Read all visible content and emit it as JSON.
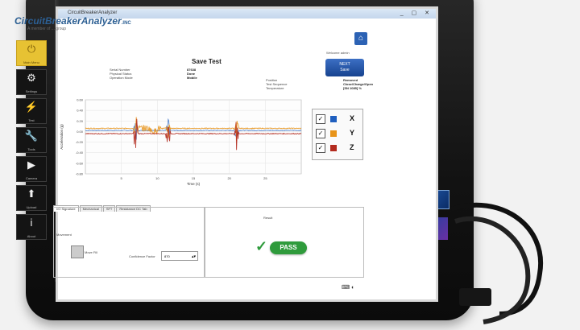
{
  "window": {
    "title": "CircuitBreakerAnalyzer",
    "controls": "_ ▢ ✕"
  },
  "brand": {
    "name": "CircuitBreakerAnalyzer",
    "suffix": ".INC",
    "tagline": "A member of ... group"
  },
  "sidebar": {
    "items": [
      {
        "label": "Main Menu",
        "icon": "breaker-icon",
        "glyph": "⏻",
        "active": true
      },
      {
        "label": "Settings",
        "icon": "gears-icon",
        "glyph": "⚙",
        "active": false
      },
      {
        "label": "Test",
        "icon": "plug-icon",
        "glyph": "⚡",
        "active": false
      },
      {
        "label": "Tools",
        "icon": "wrench-icon",
        "glyph": "🔧",
        "active": false
      },
      {
        "label": "Camera",
        "icon": "camera-icon",
        "glyph": "▶",
        "active": false
      },
      {
        "label": "Upload",
        "icon": "upload-icon",
        "glyph": "⬆",
        "active": false
      },
      {
        "label": "About",
        "icon": "info-icon",
        "glyph": "i",
        "active": false
      }
    ]
  },
  "header": {
    "title": "Save Test",
    "next_label": "NEXT",
    "next_sub": "Save",
    "welcome": "Welcome admin",
    "fields": [
      {
        "label": "Serial Number",
        "value": "87638"
      },
      {
        "label": "Physical Status",
        "value": "Done"
      },
      {
        "label": "Operation Mode",
        "value": "Mobile"
      },
      {
        "label": "Position",
        "value": "Removed"
      },
      {
        "label": "Test Sequence",
        "value": "Close/Charge/Open"
      },
      {
        "label": "Temperature",
        "value": "[SN 1085] %"
      }
    ]
  },
  "chart_data": {
    "type": "line",
    "title": "",
    "xlabel": "Time (s)",
    "ylabel": "Acceleration (g)",
    "xlim": [
      0,
      30
    ],
    "ylim": [
      -0.8,
      0.6
    ],
    "x_ticks": [
      "5",
      "10",
      "15",
      "20",
      "25"
    ],
    "y_ticks": [
      "0.60",
      "0.40",
      "0.20",
      "0.00",
      "-0.20",
      "-0.40",
      "-0.60",
      "-0.80"
    ],
    "grid": true,
    "legend": "right",
    "series": [
      {
        "name": "X",
        "color": "#1f5fbf",
        "baseline": 0.02
      },
      {
        "name": "Y",
        "color": "#e8941a",
        "baseline": 0.06
      },
      {
        "name": "Z",
        "color": "#b32a1e",
        "baseline": -0.04
      }
    ],
    "events": [
      {
        "x": 7.0,
        "amp": 0.55,
        "noise_to": 10.5
      },
      {
        "x": 11.5,
        "amp": 0.45
      },
      {
        "x": 21.0,
        "amp": 0.45
      }
    ]
  },
  "legend": {
    "items": [
      {
        "label": "X",
        "checked": "✓",
        "color": "#1f5fbf"
      },
      {
        "label": "Y",
        "checked": "✓",
        "color": "#e8941a"
      },
      {
        "label": "Z",
        "checked": "✓",
        "color": "#b32a1e"
      }
    ]
  },
  "tabs": [
    "I/O Signature",
    "Mechanical",
    "SFT",
    "Resistance DC Tab"
  ],
  "bottom": {
    "move_label": "Movement",
    "move_fill_label": "Move Fill",
    "confidence_label": "Confidence Factor",
    "confidence_value": "870",
    "result_label": "Result",
    "result_value": "PASS"
  }
}
